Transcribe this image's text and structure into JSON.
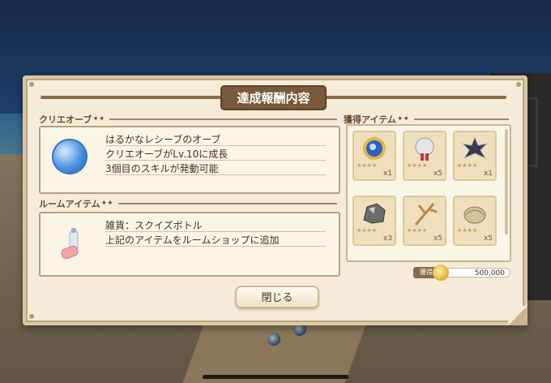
{
  "dialog": {
    "title": "達成報酬内容",
    "close_label": "閉じる"
  },
  "crie_orb": {
    "header": "クリエオーブ",
    "name": "はるかなレシーブのオーブ",
    "line1": "クリエオーブがLv.10に成長",
    "line2": "3個目のスキルが発動可能"
  },
  "room_item": {
    "header": "ルームアイテム",
    "name": "雑貨：スクイズボトル",
    "line1": "上記のアイテムをルームショップに追加"
  },
  "obtained": {
    "header": "獲得アイテム",
    "items": [
      {
        "icon": "blue-orb-medal-icon",
        "quantity": "x1"
      },
      {
        "icon": "silver-medal-ribbon-icon",
        "quantity": "x5"
      },
      {
        "icon": "dark-crystal-icon",
        "quantity": "x1"
      },
      {
        "icon": "ore-rock-icon",
        "quantity": "x3"
      },
      {
        "icon": "branch-icon",
        "quantity": "x5"
      },
      {
        "icon": "fossil-shell-icon",
        "quantity": "x5"
      }
    ]
  },
  "gold": {
    "label": "獲得",
    "value": "500,000"
  },
  "colors": {
    "panel": "#f4ecd8",
    "title_plate": "#7a5a3c",
    "accent_brown": "#8a6b4a"
  }
}
